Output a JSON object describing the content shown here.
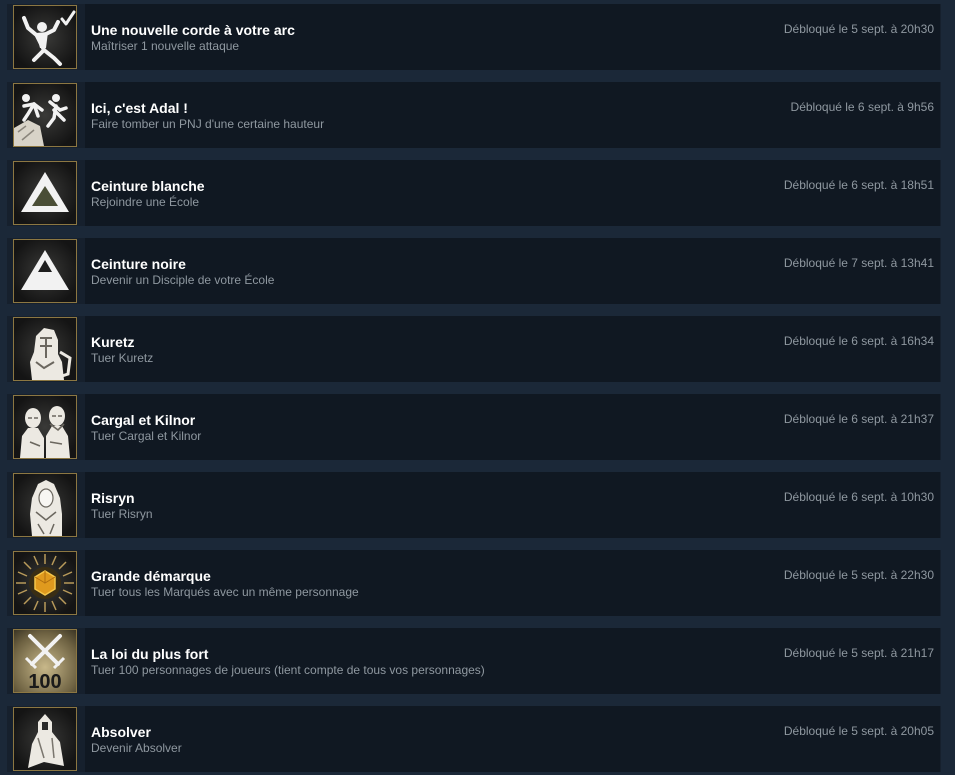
{
  "achievements": [
    {
      "icon": "dancing-figure-check-icon",
      "title": "Une nouvelle corde à votre arc",
      "description": "Maîtriser 1 nouvelle attaque",
      "unlocked": "Débloqué le 5 sept. à 20h30"
    },
    {
      "icon": "push-off-cliff-icon",
      "title": "Ici, c'est Adal !",
      "description": "Faire tomber un PNJ d'une certaine hauteur",
      "unlocked": "Débloqué le 6 sept. à 9h56"
    },
    {
      "icon": "white-belt-triangle-icon",
      "title": "Ceinture blanche",
      "description": "Rejoindre une École",
      "unlocked": "Débloqué le 6 sept. à 18h51"
    },
    {
      "icon": "black-belt-triangle-icon",
      "title": "Ceinture noire",
      "description": "Devenir un Disciple de votre École",
      "unlocked": "Débloqué le 7 sept. à 13h41"
    },
    {
      "icon": "kuretz-portrait-icon",
      "title": "Kuretz",
      "description": "Tuer Kuretz",
      "unlocked": "Débloqué le 6 sept. à 16h34"
    },
    {
      "icon": "twin-portrait-icon",
      "title": "Cargal et Kilnor",
      "description": "Tuer Cargal et Kilnor",
      "unlocked": "Débloqué le 6 sept. à 21h37"
    },
    {
      "icon": "risryn-portrait-icon",
      "title": "Risryn",
      "description": "Tuer Risryn",
      "unlocked": "Débloqué le 6 sept. à 10h30"
    },
    {
      "icon": "golden-hexagon-burst-icon",
      "title": "Grande démarque",
      "description": "Tuer tous les Marqués avec un même personnage",
      "unlocked": "Débloqué le 5 sept. à 22h30"
    },
    {
      "icon": "crossed-swords-100-icon",
      "icon_text": "100",
      "title": "La loi du plus fort",
      "description": "Tuer 100 personnages de joueurs (tient compte de tous vos personnages)",
      "unlocked": "Débloqué le 5 sept. à 21h17"
    },
    {
      "icon": "hooded-cloak-icon",
      "title": "Absolver",
      "description": "Devenir Absolver",
      "unlocked": "Débloqué le 5 sept. à 20h05"
    }
  ]
}
